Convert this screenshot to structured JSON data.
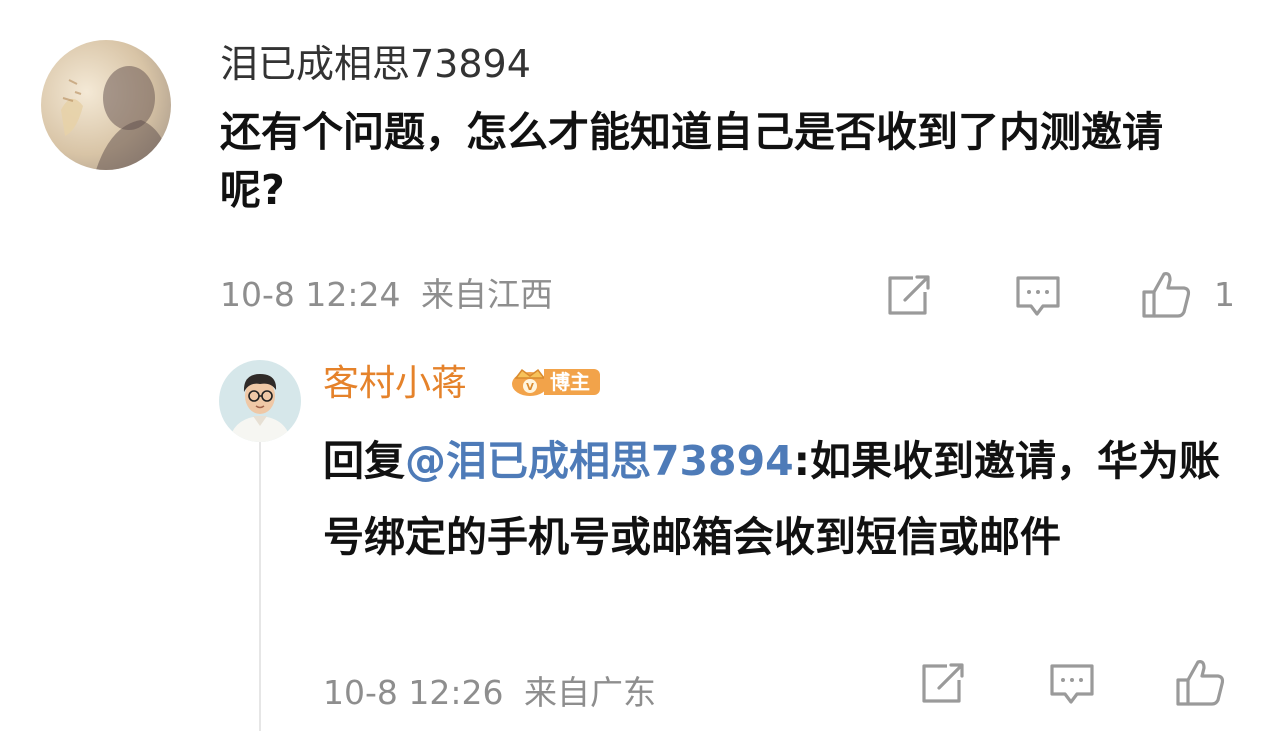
{
  "comment": {
    "username": "泪已成相思73894",
    "text": "还有个问题，怎么才能知道自己是否收到了内测邀请呢?",
    "timestamp": "10-8 12:24",
    "location": "来自江西",
    "like_count": "1",
    "avatar_icon": "user-avatar-photo"
  },
  "reply": {
    "username": "客村小蒋",
    "username_color": "#e5822a",
    "badge_label": "博主",
    "badge_color": "#f2a34a",
    "reply_prefix": "回复",
    "mention": "@泪已成相思73894",
    "mention_color": "#4e7bb8",
    "text": ":如果收到邀请，华为账号绑定的手机号或邮箱会收到短信或邮件",
    "timestamp": "10-8 12:26",
    "location": "来自广东",
    "avatar_icon": "blogger-avatar-illustration"
  },
  "actions": {
    "repost_icon": "repost-icon",
    "comment_icon": "comment-icon",
    "like_icon": "thumbs-up-icon"
  }
}
